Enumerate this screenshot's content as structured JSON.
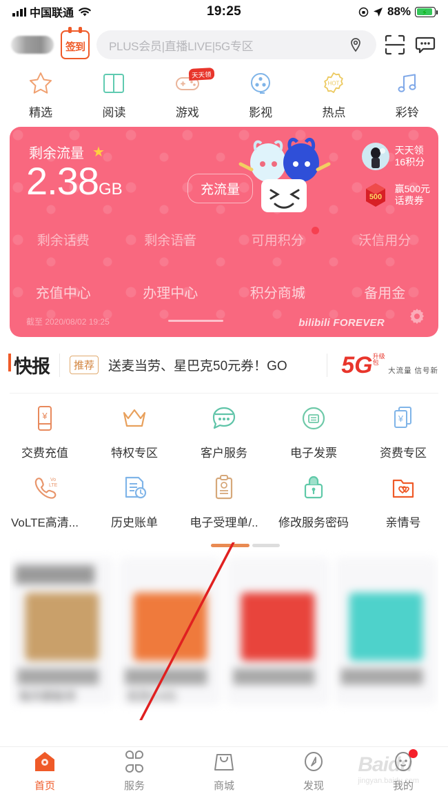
{
  "status_bar": {
    "carrier": "中国联通",
    "time": "19:25",
    "battery_percent": "88%",
    "wifi_icon": "wifi-icon",
    "lock_rotation_icon": "rotation-lock-icon",
    "location_arrow_icon": "location-arrow-icon",
    "battery_icon": "battery-charging-icon"
  },
  "header": {
    "username_blurred": "",
    "signin_label": "签到",
    "search_placeholder": "PLUS会员|直播LIVE|5G专区",
    "location_icon": "location-pin-icon",
    "scan_icon": "scan-icon",
    "message_icon": "message-bubble-icon"
  },
  "nav_icons": [
    {
      "label": "精选",
      "icon": "star-outline-icon",
      "color": "#f0a070",
      "badge": ""
    },
    {
      "label": "阅读",
      "icon": "book-open-icon",
      "color": "#5fcab0",
      "badge": ""
    },
    {
      "label": "游戏",
      "icon": "gamepad-icon",
      "color": "#eab49a",
      "badge": "天天领"
    },
    {
      "label": "影视",
      "icon": "film-reel-icon",
      "color": "#7fb4e8",
      "badge": ""
    },
    {
      "label": "热点",
      "icon": "hot-badge-icon",
      "color": "#ecc95f",
      "badge": ""
    },
    {
      "label": "彩铃",
      "icon": "music-note-icon",
      "color": "#7fa8e8",
      "badge": ""
    }
  ],
  "balance_card": {
    "bg_color": "#f9687f",
    "title": "剩余流量",
    "star_icon": "star-filled-icon",
    "value": "2.38",
    "unit": "GB",
    "recharge_button": "充流量",
    "promos": [
      {
        "title": "天天领",
        "subtitle": "16积分",
        "icon": "daily-reward-icon"
      },
      {
        "title": "赢500元",
        "subtitle": "话费券",
        "icon": "red-packet-icon"
      }
    ],
    "stats": [
      {
        "label": "剩余话费",
        "has_dot": false
      },
      {
        "label": "剩余语音",
        "has_dot": false
      },
      {
        "label": "可用积分",
        "has_dot": true
      },
      {
        "label": "沃信用分",
        "has_dot": false
      }
    ],
    "links": [
      "充值中心",
      "办理中心",
      "积分商城",
      "备用金"
    ],
    "updated_text": "截至 2020/08/02 19:25",
    "brand_text": "bilibili FOREVER",
    "settings_icon": "gear-icon",
    "mascot_icon": "bilibili-mascots-icon"
  },
  "news_bar": {
    "section_label": "快报",
    "tag": "推荐",
    "headline": "送麦当劳、星巴克50元券！GO",
    "promo_5g": {
      "big": "5G",
      "sup_line1": "升级",
      "sup_line2": "包",
      "sub": "大流量 信号新"
    }
  },
  "service_grid": [
    {
      "label": "交费充值",
      "icon": "phone-yen-icon",
      "color": "#e8895c"
    },
    {
      "label": "特权专区",
      "icon": "crown-icon",
      "color": "#e8a05c"
    },
    {
      "label": "客户服务",
      "icon": "chat-service-icon",
      "color": "#5fc4a8"
    },
    {
      "label": "电子发票",
      "icon": "invoice-circle-icon",
      "color": "#6ec9a8"
    },
    {
      "label": "资费专区",
      "icon": "cards-yen-icon",
      "color": "#7fb4e8"
    },
    {
      "label": "VoLTE高清...",
      "icon": "volte-phone-icon",
      "color": "#e8956b"
    },
    {
      "label": "历史账单",
      "icon": "bill-clock-icon",
      "color": "#7fb4e8"
    },
    {
      "label": "电子受理单/..",
      "icon": "clipboard-icon",
      "color": "#d6a87a"
    },
    {
      "label": "修改服务密码",
      "icon": "lock-icon",
      "color": "#5fc9a8"
    },
    {
      "label": "亲情号",
      "icon": "folder-heart-icon",
      "color": "#ef5a28"
    }
  ],
  "carousel": {
    "tab_active_color": "#e98a52",
    "items": [
      {
        "caption": "每天都能领",
        "tint": "#c9a06a"
      },
      {
        "caption": "低至9.9元",
        "tint": "#ef7a3c"
      },
      {
        "caption": "",
        "tint": "#e8443c"
      },
      {
        "caption": "",
        "tint": "#4ed2cb"
      }
    ],
    "annotation_line_color": "#e02020"
  },
  "tab_bar": {
    "active_index": 0,
    "active_color": "#ef5a28",
    "inactive_color": "#8a8a8a",
    "items": [
      {
        "label": "首页",
        "icon": "home-icon",
        "badge": false
      },
      {
        "label": "服务",
        "icon": "grid-clover-icon",
        "badge": false
      },
      {
        "label": "商城",
        "icon": "shopping-bag-icon",
        "badge": false
      },
      {
        "label": "发现",
        "icon": "compass-icon",
        "badge": false
      },
      {
        "label": "我的",
        "icon": "profile-mascot-icon",
        "badge": true
      }
    ]
  },
  "watermark": {
    "text": "Baidu",
    "sub": "jingyan.baidu.com"
  }
}
